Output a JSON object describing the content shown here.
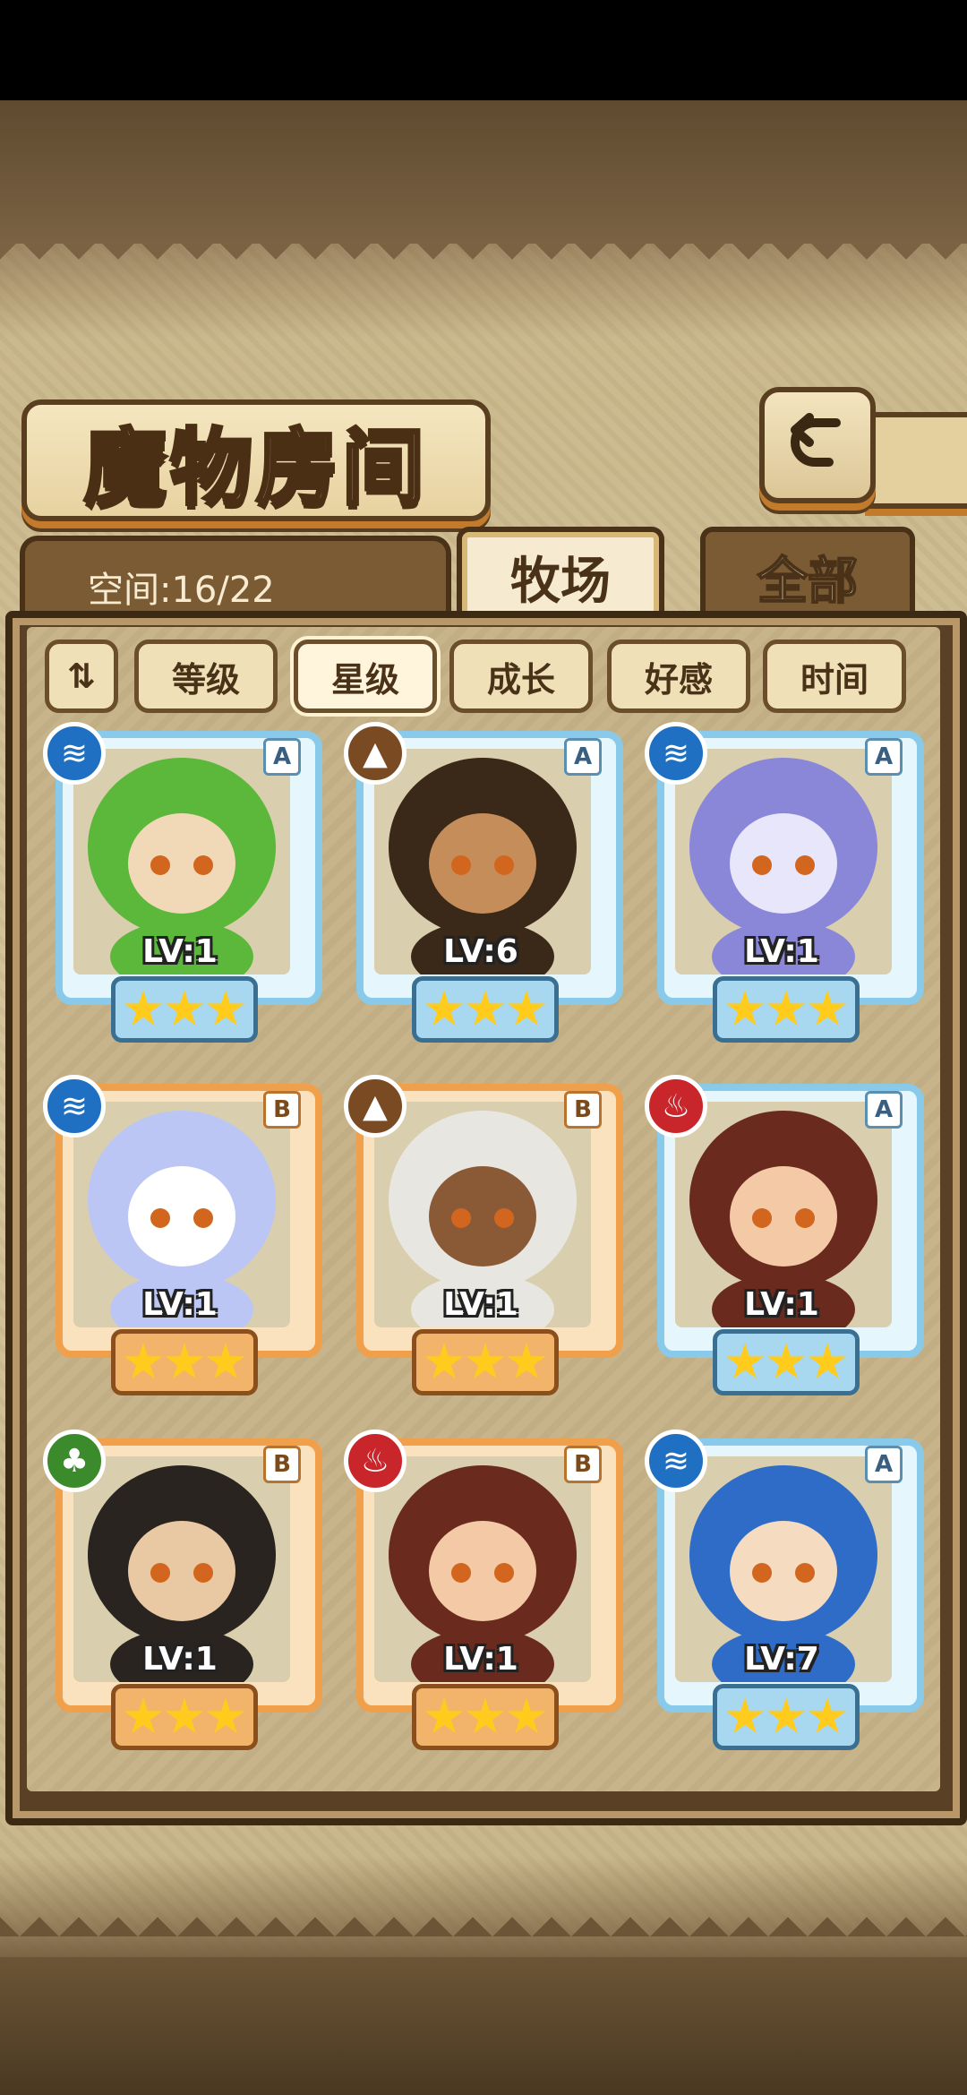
{
  "header": {
    "title": "魔物房间",
    "back_icon": "↩"
  },
  "storage": {
    "label": "空间:16/22"
  },
  "tabs": [
    {
      "label": "牧场",
      "active": true
    },
    {
      "label": "全部",
      "active": false
    }
  ],
  "sort_toggle_icon": "⇅",
  "filters": [
    {
      "label": "等级",
      "active": false
    },
    {
      "label": "星级",
      "active": true
    },
    {
      "label": "成长",
      "active": false
    },
    {
      "label": "好感",
      "active": false
    },
    {
      "label": "时间",
      "active": false
    }
  ],
  "cards": [
    {
      "element": "water",
      "element_glyph": "≋",
      "element_color": "#1f6fc2",
      "rank": "A",
      "level": "LV:1",
      "stars": 3,
      "frame": "blue",
      "art_color": "#5bb83a",
      "art_accent": "#f1d9b8"
    },
    {
      "element": "earth",
      "element_glyph": "▲",
      "element_color": "#7a4a22",
      "rank": "A",
      "level": "LV:6",
      "stars": 3,
      "frame": "blue",
      "art_color": "#3a2818",
      "art_accent": "#c58d5a"
    },
    {
      "element": "water",
      "element_glyph": "≋",
      "element_color": "#1f6fc2",
      "rank": "A",
      "level": "LV:1",
      "stars": 3,
      "frame": "blue",
      "art_color": "#8a86d8",
      "art_accent": "#e7e6fb"
    },
    {
      "element": "water",
      "element_glyph": "≋",
      "element_color": "#1f6fc2",
      "rank": "B",
      "level": "LV:1",
      "stars": 3,
      "frame": "orange",
      "art_color": "#bcc6f5",
      "art_accent": "#ffffff"
    },
    {
      "element": "earth",
      "element_glyph": "▲",
      "element_color": "#7a4a22",
      "rank": "B",
      "level": "LV:1",
      "stars": 3,
      "frame": "orange",
      "art_color": "#e8e6e0",
      "art_accent": "#8a5a36"
    },
    {
      "element": "fire",
      "element_glyph": "♨",
      "element_color": "#c8262a",
      "rank": "A",
      "level": "LV:1",
      "stars": 3,
      "frame": "blue",
      "art_color": "#6a2b1e",
      "art_accent": "#f3c9a6"
    },
    {
      "element": "wood",
      "element_glyph": "♣",
      "element_color": "#3b8a2c",
      "rank": "B",
      "level": "LV:1",
      "stars": 3,
      "frame": "orange",
      "art_color": "#2a2420",
      "art_accent": "#e9c9a3"
    },
    {
      "element": "fire",
      "element_glyph": "♨",
      "element_color": "#c8262a",
      "rank": "B",
      "level": "LV:1",
      "stars": 3,
      "frame": "orange",
      "art_color": "#6a2b1e",
      "art_accent": "#f3c9a6"
    },
    {
      "element": "water",
      "element_glyph": "≋",
      "element_color": "#1f6fc2",
      "rank": "A",
      "level": "LV:7",
      "stars": 3,
      "frame": "blue",
      "art_color": "#2f6cc8",
      "art_accent": "#f5dcc0"
    }
  ]
}
